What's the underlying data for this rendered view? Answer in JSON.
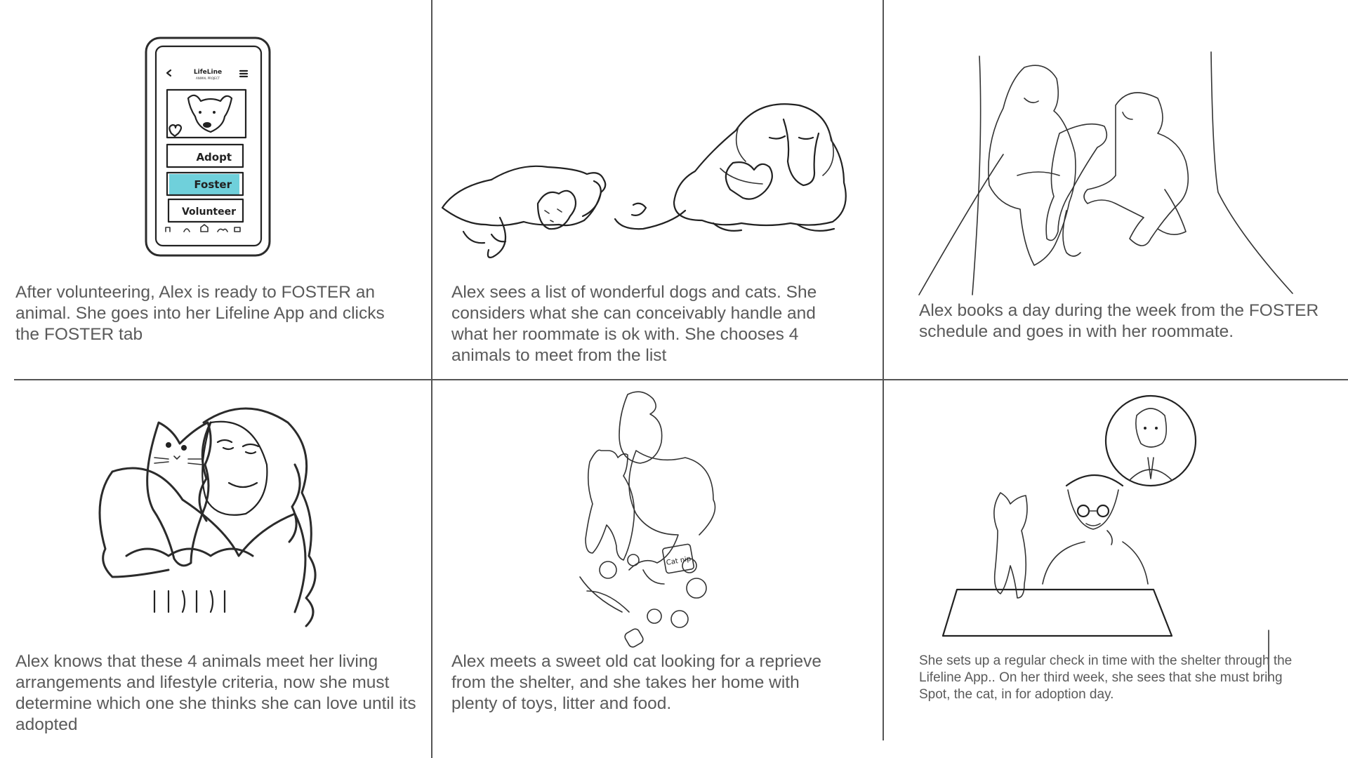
{
  "panels": [
    {
      "caption": "After volunteering, Alex is ready to FOSTER an animal. She goes into her Lifeline App and clicks the FOSTER tab",
      "phone": {
        "logo": "LifeLine",
        "logo_sub": "ANIMAL PROJECT",
        "buttons": [
          "Adopt",
          "Foster",
          "Volunteer"
        ],
        "highlight_color": "#6fd0db"
      }
    },
    {
      "caption": "Alex sees a list of wonderful dogs and cats. She considers what she can conceivably handle and what her roommate is ok with. She chooses 4 animals to meet from the list"
    },
    {
      "caption": "Alex books a day during the week from the FOSTER schedule and goes in with her roommate."
    },
    {
      "caption": "Alex knows that these 4 animals meet her living arrangements and lifestyle criteria, now she must determine which one she thinks she can love until its adopted"
    },
    {
      "caption": "Alex meets a sweet old cat looking for a reprieve from the shelter, and she takes her home with plenty of toys, litter and food.",
      "toy_label": "Cat nip"
    },
    {
      "caption": "She sets up a regular check in time with the shelter through the Lifeline App.. On her third week, she sees that she must bring Spot, the cat, in for adoption day."
    }
  ]
}
